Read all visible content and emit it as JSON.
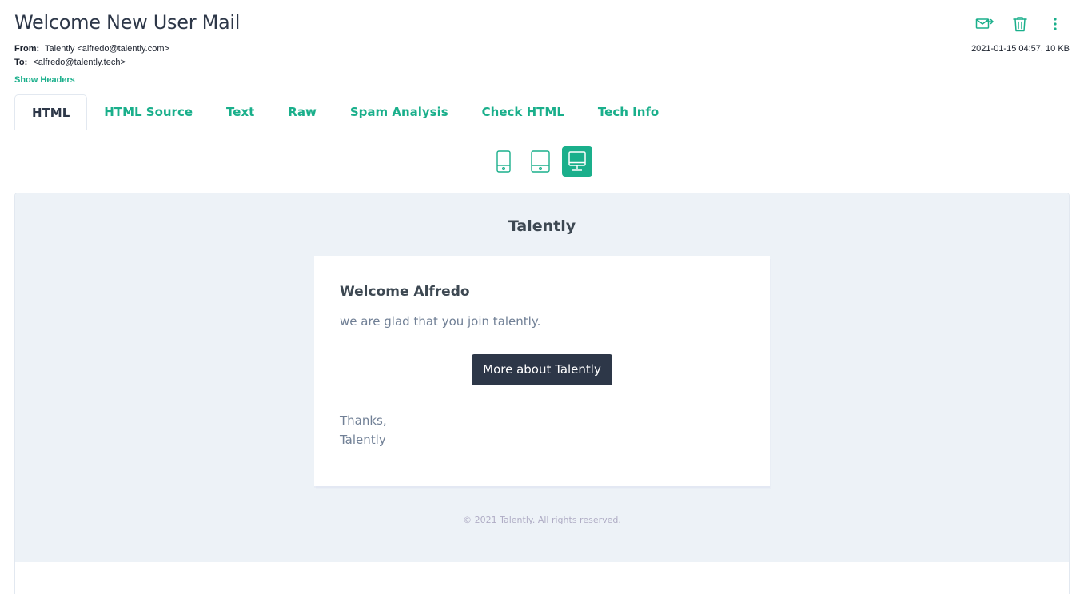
{
  "email": {
    "subject": "Welcome New User Mail",
    "from_label": "From:",
    "from_value": "Talently <alfredo@talently.com>",
    "to_label": "To:",
    "to_value": "<alfredo@talently.tech>",
    "show_headers": "Show Headers",
    "date_size": "2021-01-15 04:57, 10 KB"
  },
  "actions": [
    {
      "name": "forward-icon"
    },
    {
      "name": "trash-icon"
    },
    {
      "name": "more-vertical-icon"
    }
  ],
  "tabs": [
    {
      "label": "HTML",
      "active": true
    },
    {
      "label": "HTML Source"
    },
    {
      "label": "Text"
    },
    {
      "label": "Raw"
    },
    {
      "label": "Spam Analysis"
    },
    {
      "label": "Check HTML"
    },
    {
      "label": "Tech Info"
    }
  ],
  "devices": [
    {
      "name": "mobile-icon"
    },
    {
      "name": "tablet-icon"
    },
    {
      "name": "desktop-icon",
      "active": true
    }
  ],
  "preview": {
    "brand": "Talently",
    "title": "Welcome Alfredo",
    "text": "we are glad that you join talently.",
    "button": "More about Talently",
    "sign_1": "Thanks,",
    "sign_2": "Talently",
    "footer": "© 2021 Talently. All rights reserved."
  },
  "colors": {
    "accent": "#1aaf8b",
    "dark": "#2d3748",
    "email_bg": "#edf2f7"
  }
}
